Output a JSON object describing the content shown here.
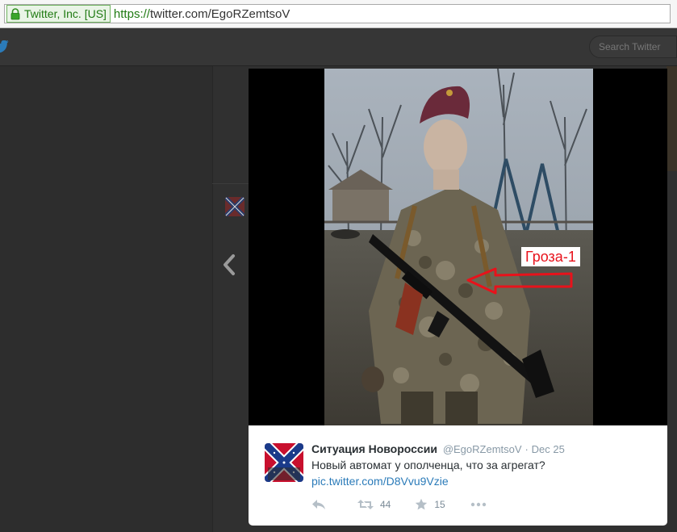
{
  "browser": {
    "ev_label": "Twitter, Inc. [US]",
    "url_scheme": "https://",
    "url_rest": "twitter.com/EgoRZemtsoV"
  },
  "twitter_header": {
    "search_placeholder": "Search Twitter"
  },
  "media": {
    "annotation_label": "Гроза-1",
    "annotation_color": "#e8121b"
  },
  "tweet": {
    "author_name": "Ситуация Новороссии",
    "author_handle": "@EgoRZemtsoV",
    "separator": "·",
    "date": "Dec 25",
    "text": "Новый автомат у ополченца, что за агрегат?",
    "link": "pic.twitter.com/D8Vvu9Vzie",
    "retweets": "44",
    "favorites": "15"
  },
  "colors": {
    "link": "#2b7bb9",
    "ev_green": "#1f7a12",
    "muted": "#8899a6"
  }
}
